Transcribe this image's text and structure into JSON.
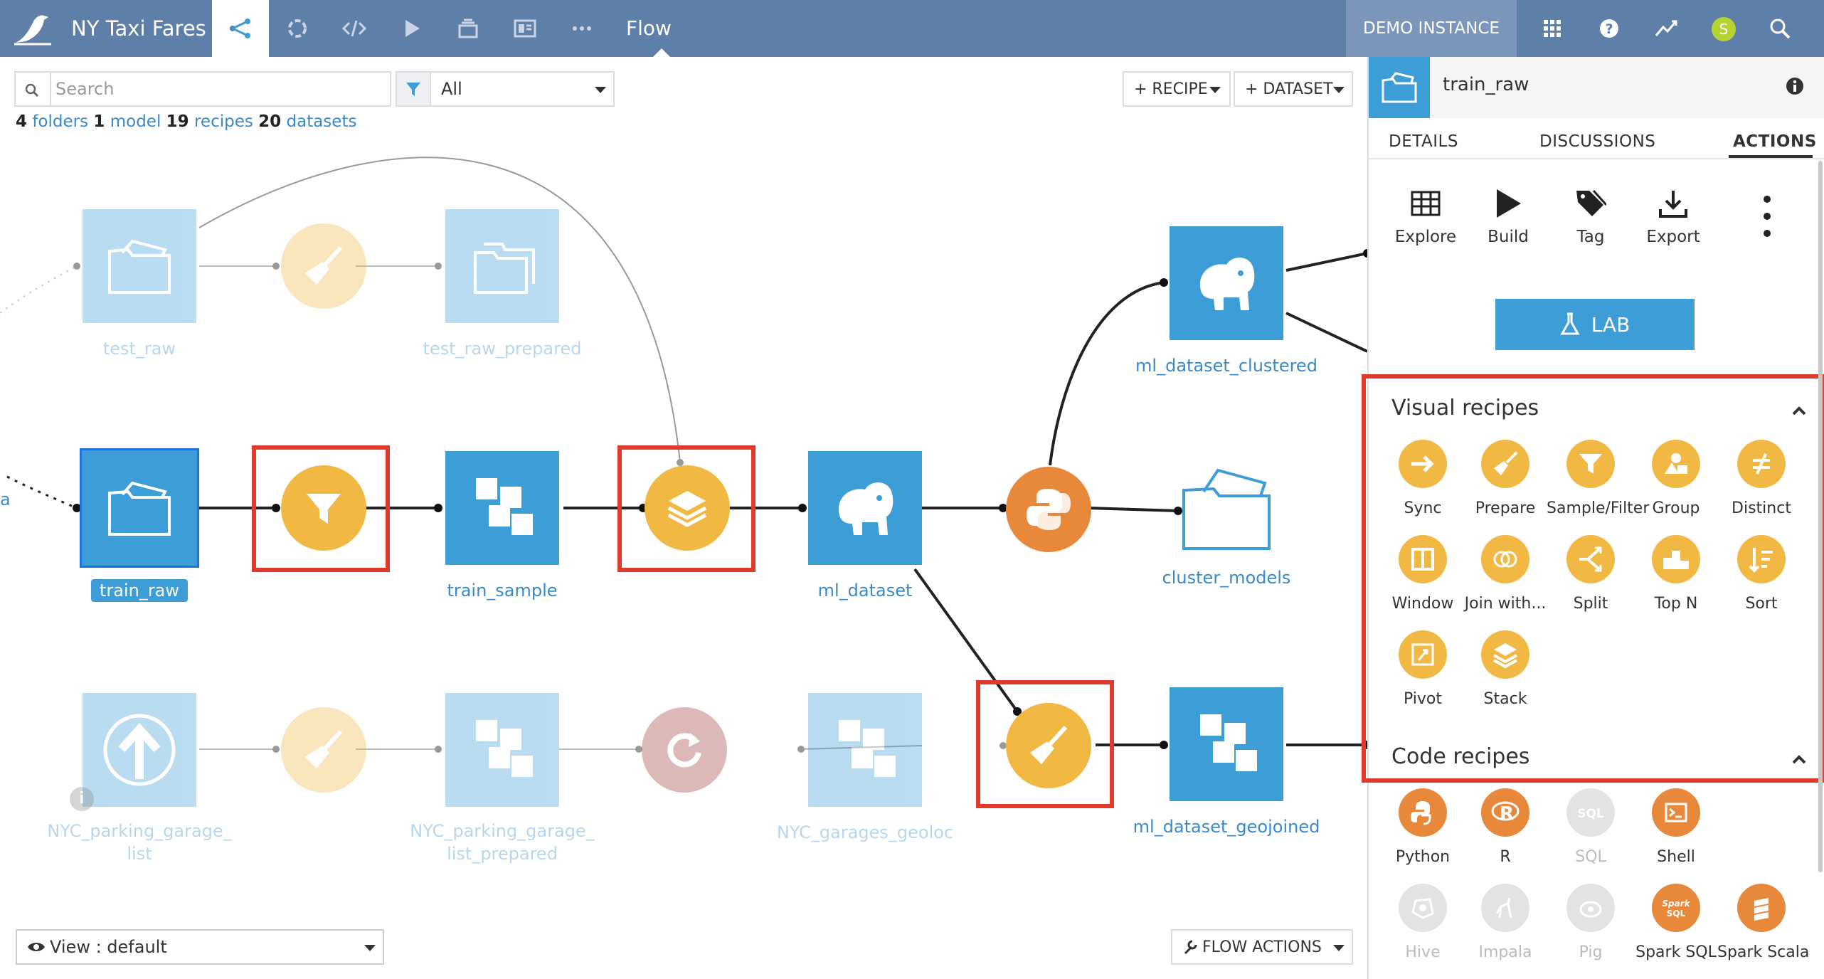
{
  "topbar": {
    "project_name": "NY Taxi Fares",
    "current_view": "Flow",
    "instance_label": "DEMO INSTANCE",
    "user_initial": "S",
    "icons": [
      "bird-logo-icon",
      "flow-icon",
      "recipes-icon",
      "code-icon",
      "run-icon",
      "stack-icon",
      "dashboard-icon",
      "more-icon",
      "apps-grid-icon",
      "help-icon",
      "activity-icon",
      "user-avatar",
      "search-icon"
    ]
  },
  "toolbar": {
    "search_placeholder": "Search",
    "filter_value": "All",
    "recipe_button": "+ RECIPE",
    "dataset_button": "+ DATASET"
  },
  "counts": {
    "folders_num": "4",
    "folders_label": "folders",
    "model_num": "1",
    "model_label": "model",
    "recipes_num": "19",
    "recipes_label": "recipes",
    "datasets_num": "20",
    "datasets_label": "datasets"
  },
  "flow": {
    "left_edge_label": "a",
    "nodes": {
      "test_raw": "test_raw",
      "test_raw_prepared": "test_raw_prepared",
      "train_raw": "train_raw",
      "train_sample": "train_sample",
      "ml_dataset": "ml_dataset",
      "ml_dataset_clustered": "ml_dataset_clustered",
      "cluster_models": "cluster_models",
      "nyc_parking_garage_list_1": "NYC_parking_garage_",
      "nyc_parking_garage_list_2": "list",
      "nyc_parking_garage_list_prepared_1": "NYC_parking_garage_",
      "nyc_parking_garage_list_prepared_2": "list_prepared",
      "nyc_garages_geoloc": "NYC_garages_geoloc",
      "ml_dataset_geojoined": "ml_dataset_geojoined"
    },
    "bottom": {
      "view_label": "View : default",
      "flow_actions": "FLOW ACTIONS"
    }
  },
  "right_panel": {
    "title": "train_raw",
    "tabs": [
      "DETAILS",
      "DISCUSSIONS",
      "ACTIONS"
    ],
    "active_tab": "ACTIONS",
    "actions": [
      "Explore",
      "Build",
      "Tag",
      "Export"
    ],
    "lab_button": "LAB",
    "visual_recipes_title": "Visual recipes",
    "visual_recipes": [
      "Sync",
      "Prepare",
      "Sample/Filter",
      "Group",
      "Distinct",
      "Window",
      "Join with...",
      "Split",
      "Top N",
      "Sort",
      "Pivot",
      "Stack"
    ],
    "code_recipes_title": "Code recipes",
    "code_recipes": [
      "Python",
      "R",
      "SQL",
      "Shell",
      "Hive",
      "Impala",
      "Pig",
      "Spark SQL",
      "Spark Scala"
    ],
    "colors": {
      "visual_recipe": "#f2b844",
      "code_recipe": "#e8883a",
      "dataset_blue": "#3d9dd6",
      "highlight": "#e03a2a"
    }
  }
}
